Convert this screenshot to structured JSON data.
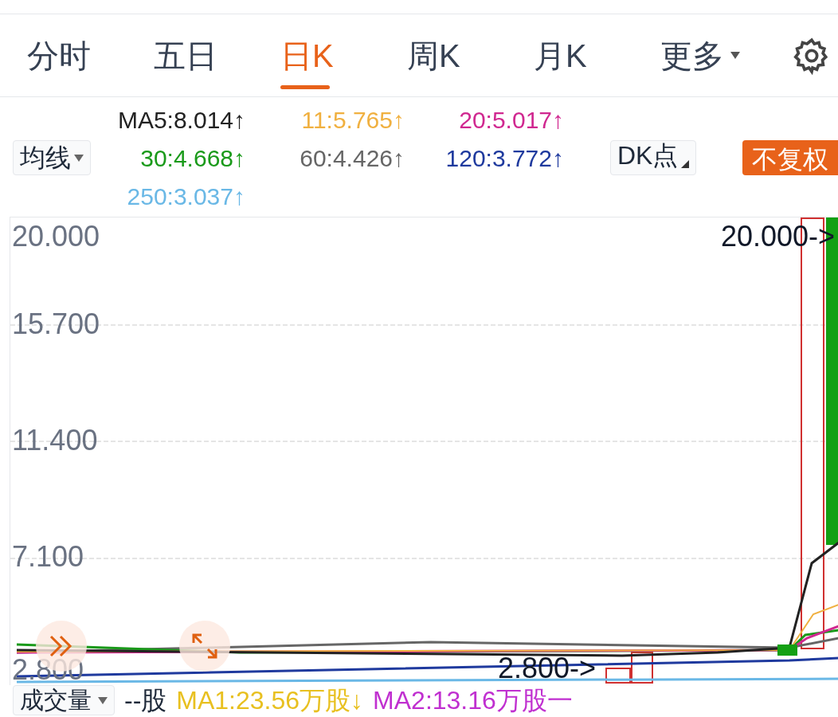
{
  "tabs": [
    {
      "label": "分时",
      "selected": false
    },
    {
      "label": "五日",
      "selected": false
    },
    {
      "label": "日K",
      "selected": true
    },
    {
      "label": "周K",
      "selected": false
    },
    {
      "label": "月K",
      "selected": false
    },
    {
      "label": "更多",
      "selected": false,
      "kind": "dropdown"
    }
  ],
  "indicator_bar": {
    "selector": "均线",
    "ma_values": [
      {
        "text": "MA5:8.014↑",
        "color": "#222222"
      },
      {
        "text": "11:5.765↑",
        "color": "#f0b040"
      },
      {
        "text": "20:5.017↑",
        "color": "#d02890"
      },
      {
        "text": "30:4.668↑",
        "color": "#1a9a1a"
      },
      {
        "text": "60:4.426↑",
        "color": "#666666"
      },
      {
        "text": "120:3.772↑",
        "color": "#1f3a9e"
      },
      {
        "text": "250:3.037↑",
        "color": "#6ab8e6"
      }
    ],
    "dk_button": "DK点",
    "adjust_button": "不复权"
  },
  "chart": {
    "y_labels": [
      "20.000",
      "15.700",
      "11.400",
      "7.100",
      "2.800"
    ],
    "max_marker": "20.000->",
    "min_marker": "2.800->"
  },
  "volume_bar": {
    "selector": "成交量",
    "value": "--股",
    "ma1": "MA1:23.56万股↓",
    "ma2": "MA2:13.16万股一"
  }
}
